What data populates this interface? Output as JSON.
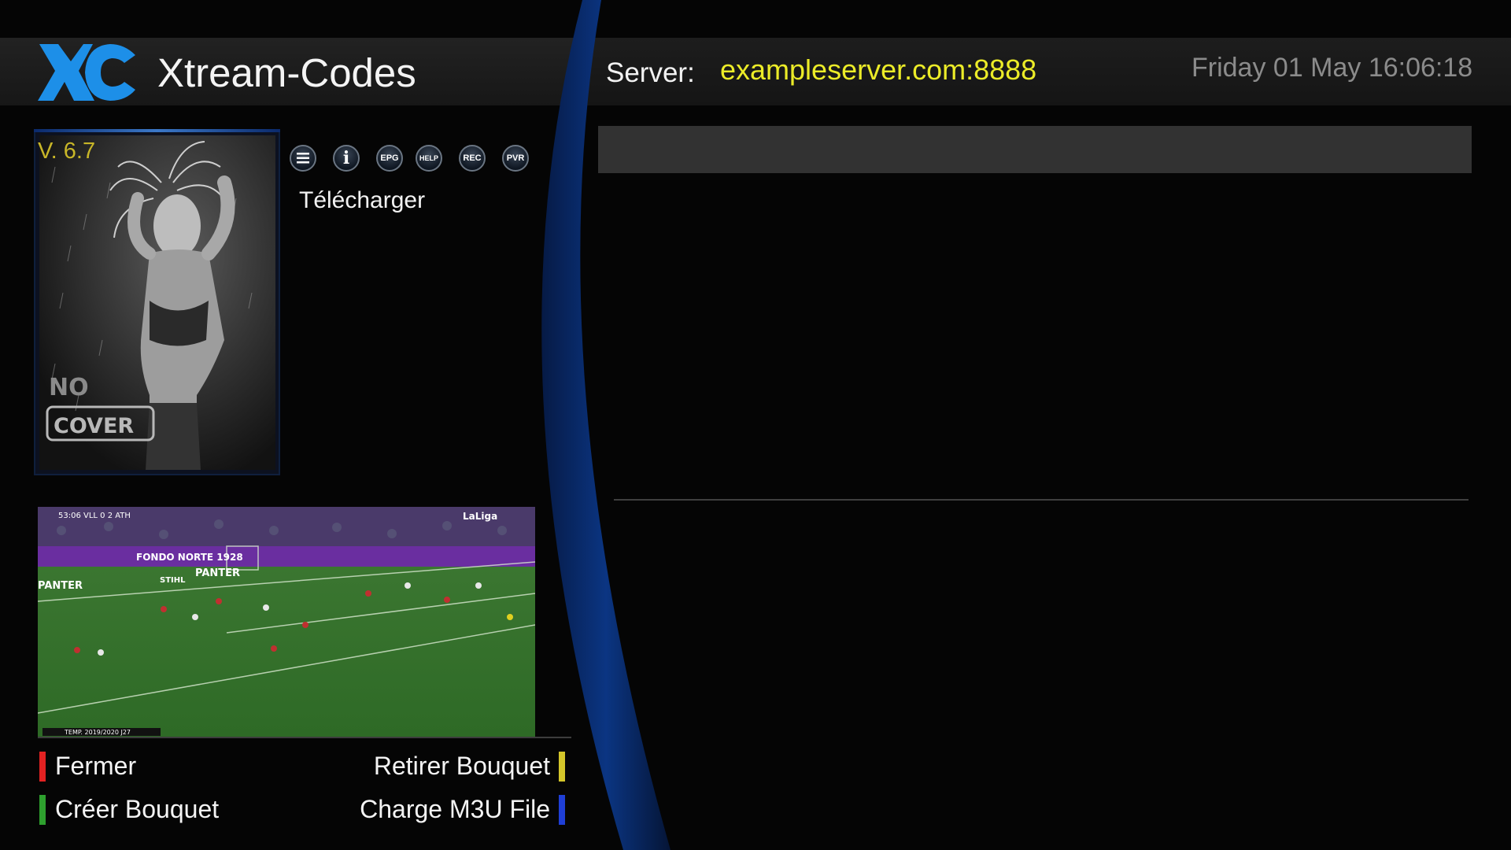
{
  "header": {
    "app_title": "Xtream-Codes",
    "logo_text": "XC",
    "server_label": "Server:",
    "server_value": "exampleserver.com:8888",
    "datetime": "Friday 01 May 16:06:18"
  },
  "sidebar": {
    "version": "V. 6.7",
    "cover_placeholder": [
      "NO",
      "COVER"
    ],
    "buttons": [
      {
        "icon": "menu-icon",
        "label": ""
      },
      {
        "icon": "info-icon",
        "label": "i"
      },
      {
        "icon": "epg-icon",
        "label": "EPG"
      },
      {
        "icon": "help-icon",
        "label": "HELP"
      },
      {
        "icon": "rec-icon",
        "label": "REC"
      },
      {
        "icon": "pvr-icon",
        "label": "PVR"
      }
    ],
    "action_label": "Télécharger"
  },
  "video_preview": {
    "scoreboard": "53:06  VLL  0  2  ATH",
    "broadcaster": "LaLiga",
    "footer": "TEMP. 2019/2020 J27",
    "ads": [
      "PANTER",
      "FONDO NORTE 1928",
      "PANTER",
      "STIHL"
    ]
  },
  "color_keys": {
    "red": {
      "label": "Fermer",
      "color": "#e32222"
    },
    "green": {
      "label": "Créer Bouquet",
      "color": "#2ea02e"
    },
    "yellow": {
      "label": "Retirer Bouquet",
      "color": "#d4c62a"
    },
    "blue": {
      "label": "Charge M3U File",
      "color": "#1f3fd6"
    }
  },
  "colors": {
    "logo_blue": "#1d8fe8",
    "server_value": "#ecec28",
    "version_text": "#c8b628",
    "arc_blue": "#0a3378"
  }
}
